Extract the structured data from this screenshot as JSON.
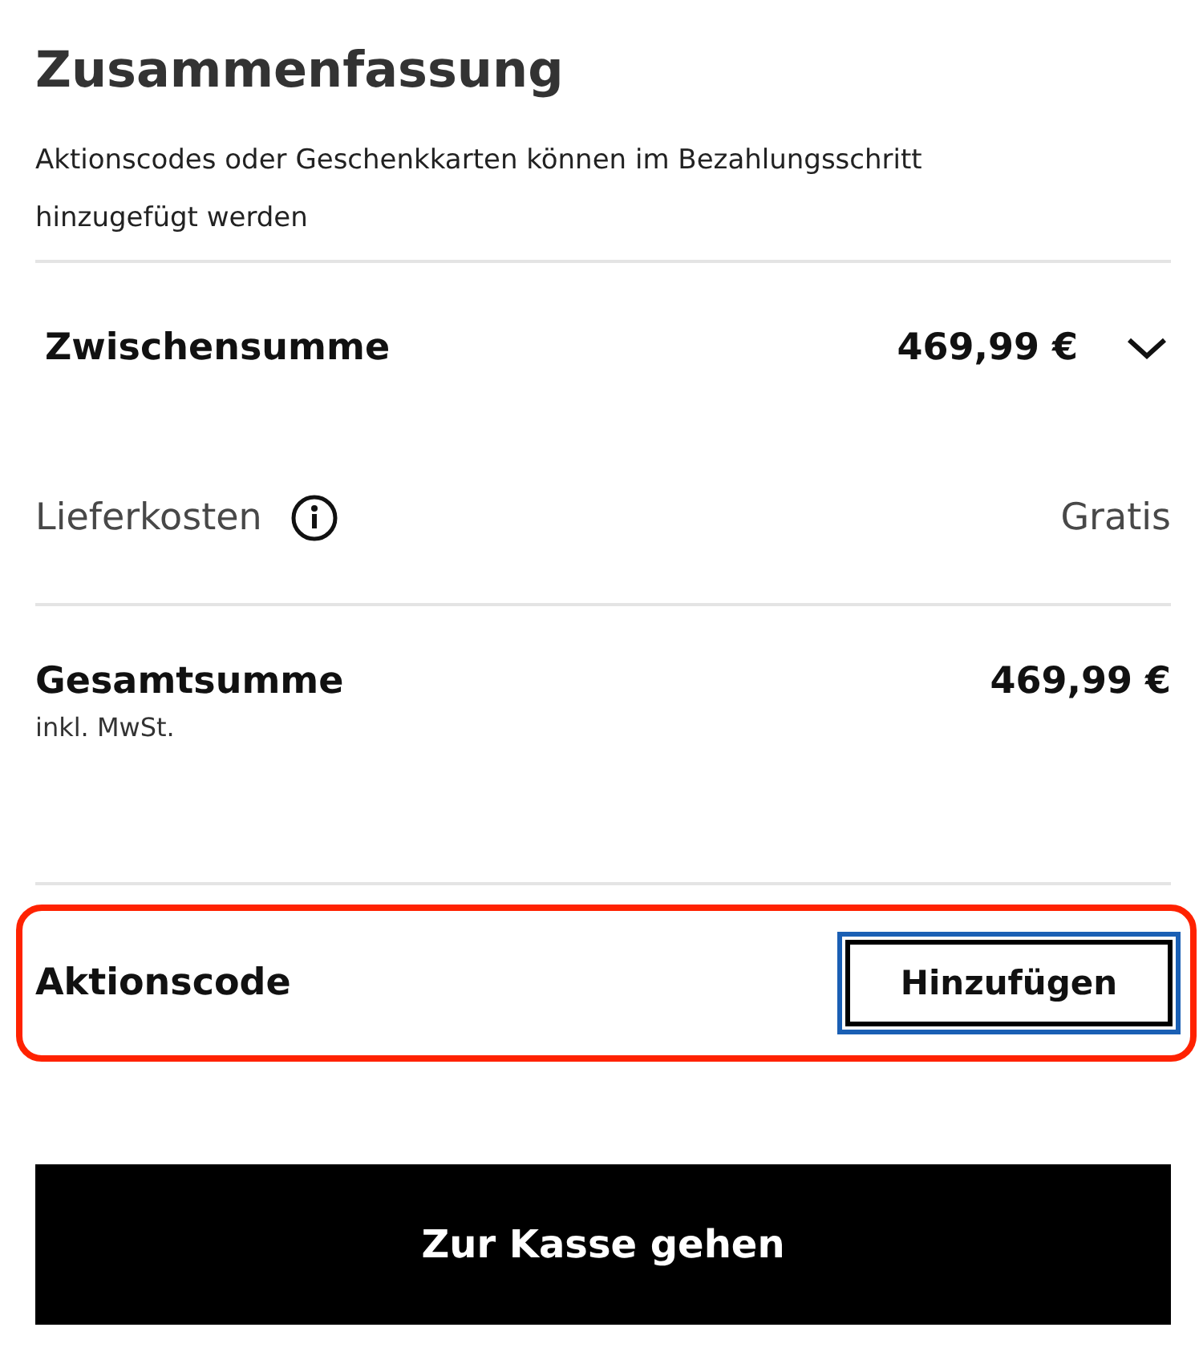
{
  "title": "Zusammenfassung",
  "note": "Aktionscodes oder Geschenkkarten können im Bezahlungsschritt hinzugefügt werden",
  "subtotal": {
    "label": "Zwischensumme",
    "amount": "469,99 €",
    "expanded": false
  },
  "delivery": {
    "label": "Lieferkosten",
    "value": "Gratis"
  },
  "total": {
    "label": "Gesamtsumme",
    "sublabel": "inkl. MwSt.",
    "amount": "469,99 €"
  },
  "promo": {
    "label": "Aktionscode",
    "highlighted": true,
    "button": {
      "label": "Hinzufügen",
      "focused": true
    }
  },
  "checkout": {
    "label": "Zur Kasse gehen"
  }
}
